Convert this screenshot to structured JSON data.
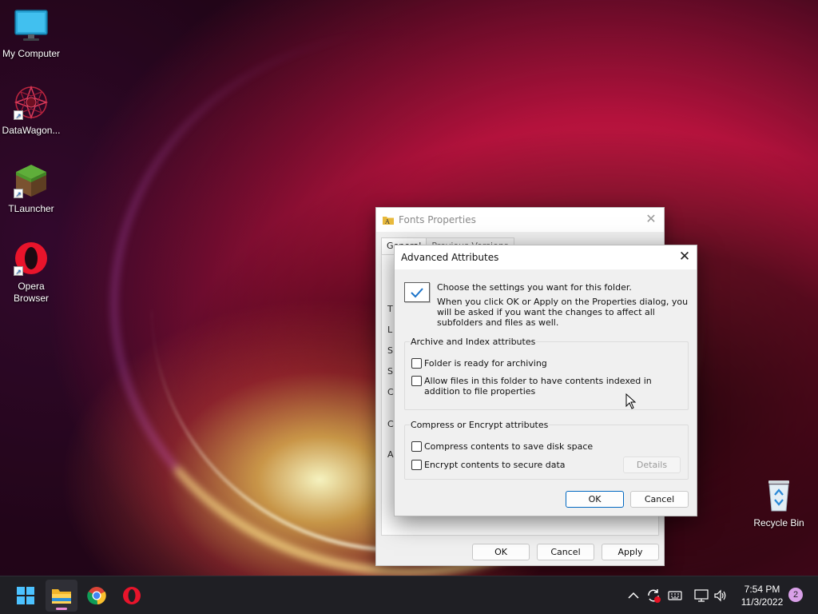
{
  "desktop": {
    "icons": [
      {
        "label": "My Computer"
      },
      {
        "label": "DataWagon..."
      },
      {
        "label": "TLauncher"
      },
      {
        "label": "Opera\nBrowser"
      },
      {
        "label": "Recycle Bin"
      }
    ],
    "shortcut_glyph": "↗"
  },
  "fonts_properties": {
    "title": "Fonts Properties",
    "close_glyph": "✕",
    "tabs": [
      "General",
      "Previous Versions"
    ],
    "side_letters": [
      "T",
      "L",
      "S",
      "S",
      "C",
      "C",
      "A"
    ],
    "buttons": {
      "ok": "OK",
      "cancel": "Cancel",
      "apply": "Apply"
    }
  },
  "advanced_attributes": {
    "title": "Advanced Attributes",
    "close_glyph": "✕",
    "info_main": "Choose the settings you want for this folder.",
    "info_sub": "When you click OK or Apply on the Properties dialog, you will be asked if you want the changes to affect all subfolders and files as well.",
    "archive_group": {
      "label": "Archive and Index attributes",
      "options": [
        {
          "label": "Folder is ready for archiving",
          "checked": false
        },
        {
          "label": "Allow files in this folder to have contents indexed in addition to file properties",
          "checked": false
        }
      ]
    },
    "compress_group": {
      "label": "Compress or Encrypt attributes",
      "options": [
        {
          "label": "Compress contents to save disk space",
          "checked": false
        },
        {
          "label": "Encrypt contents to secure data",
          "checked": false
        }
      ],
      "details_label": "Details"
    },
    "buttons": {
      "ok": "OK",
      "cancel": "Cancel"
    }
  },
  "taskbar": {
    "apps": [
      "start-icon",
      "file-explorer-icon",
      "chrome-icon",
      "opera-icon"
    ],
    "clock": {
      "time": "7:54 PM",
      "date": "11/3/2022"
    },
    "notification_count": "2",
    "colors": {
      "taskbar": "#1f1f24",
      "accent": "#0067c0",
      "active_indicator": "#e98bd4"
    }
  }
}
